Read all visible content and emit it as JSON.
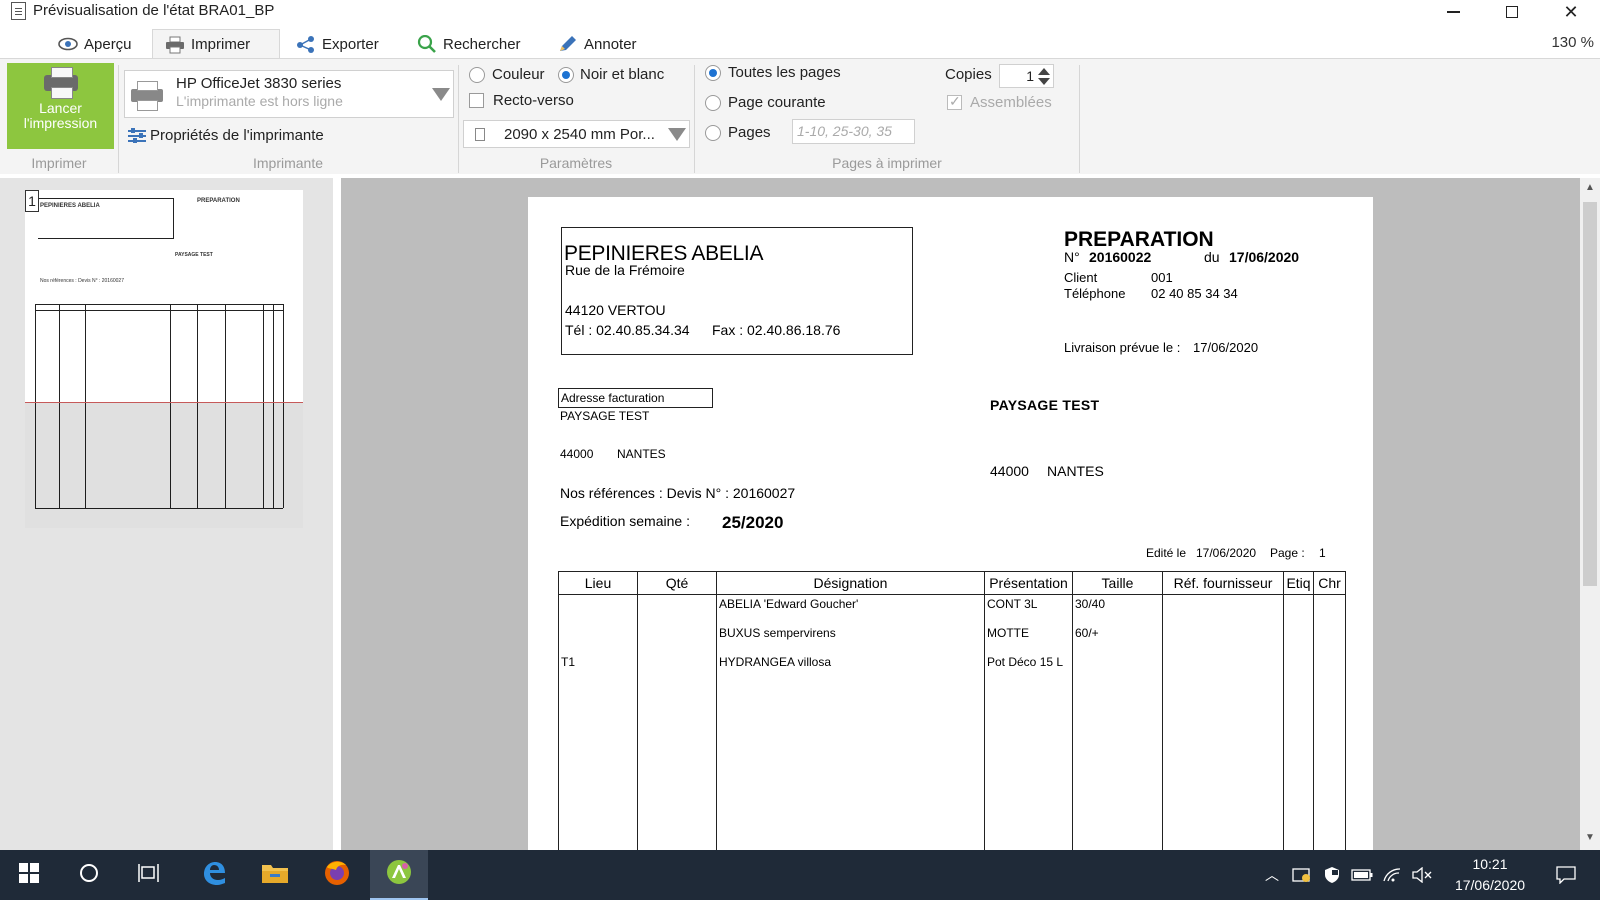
{
  "window": {
    "title": "Prévisualisation de l'état BRA01_BP"
  },
  "tabs": [
    {
      "label": "Aperçu",
      "icon": "eye-icon"
    },
    {
      "label": "Imprimer",
      "icon": "printer-icon"
    },
    {
      "label": "Exporter",
      "icon": "share-icon"
    },
    {
      "label": "Rechercher",
      "icon": "search-icon"
    },
    {
      "label": "Annoter",
      "icon": "pencil-icon"
    }
  ],
  "zoom_level": "130 %",
  "ribbon": {
    "print_button_label": "Lancer l'impression",
    "printer_name": "HP OfficeJet 3830 series",
    "printer_status": "L'imprimante est hors ligne",
    "printer_properties": "Propriétés de l'imprimante",
    "color_option": "Couleur",
    "bw_option": "Noir et blanc",
    "duplex_option": "Recto-verso",
    "paper_size": "2090 x 2540 mm Por...",
    "all_pages": "Toutes les pages",
    "current_page": "Page courante",
    "pages_option": "Pages",
    "pages_placeholder": "1-10, 25-30, 35",
    "copies_label": "Copies",
    "copies_value": "1",
    "collated_label": "Assemblées",
    "groups": [
      "Imprimer",
      "Imprimante",
      "Paramètres",
      "Pages à imprimer"
    ]
  },
  "thumbnail": {
    "page_number": "1"
  },
  "document": {
    "company_name": "PEPINIERES ABELIA",
    "company_street": "Rue de la Frémoire",
    "company_city": "44120 VERTOU",
    "company_tel": "Tél : 02.40.85.34.34",
    "company_fax": "Fax : 02.40.86.18.76",
    "title": "PREPARATION",
    "number_label": "N°",
    "number": "20160022",
    "date_label": "du",
    "date": "17/06/2020",
    "client_label": "Client",
    "client_value": "001",
    "phone_label": "Téléphone",
    "phone_value": "02 40 85 34 34",
    "delivery_label": "Livraison prévue le :",
    "delivery_value": "17/06/2020",
    "billing_box_label": "Adresse facturation",
    "billing_name": "PAYSAGE TEST",
    "billing_zip": "44000",
    "billing_city": "NANTES",
    "shipping_name": "PAYSAGE TEST",
    "shipping_zip": "44000",
    "shipping_city": "NANTES",
    "references": "Nos références : Devis N° : 20160027",
    "expedition_label": "Expédition semaine :",
    "expedition_value": "25/2020",
    "edited_label": "Edité le",
    "edited_date": "17/06/2020",
    "page_label": "Page :",
    "page_value": "1",
    "table": {
      "headers": [
        "Lieu",
        "Qté",
        "Désignation",
        "Présentation",
        "Taille",
        "Réf. fournisseur",
        "Etiq",
        "Chr"
      ],
      "rows": [
        [
          "",
          "",
          "ABELIA 'Edward Goucher'",
          "CONT 3L",
          "30/40",
          "",
          "",
          ""
        ],
        [
          "",
          "",
          "BUXUS sempervirens",
          "MOTTE",
          "60/+",
          "",
          "",
          ""
        ],
        [
          "T1",
          "",
          "HYDRANGEA villosa",
          "Pot Déco 15 L",
          "",
          "",
          "",
          ""
        ]
      ]
    }
  },
  "taskbar": {
    "time": "10:21",
    "date": "17/06/2020"
  },
  "colors": {
    "print_button": "#8dc63f",
    "taskbar": "#1f2a38",
    "accent": "#1e73d2"
  }
}
